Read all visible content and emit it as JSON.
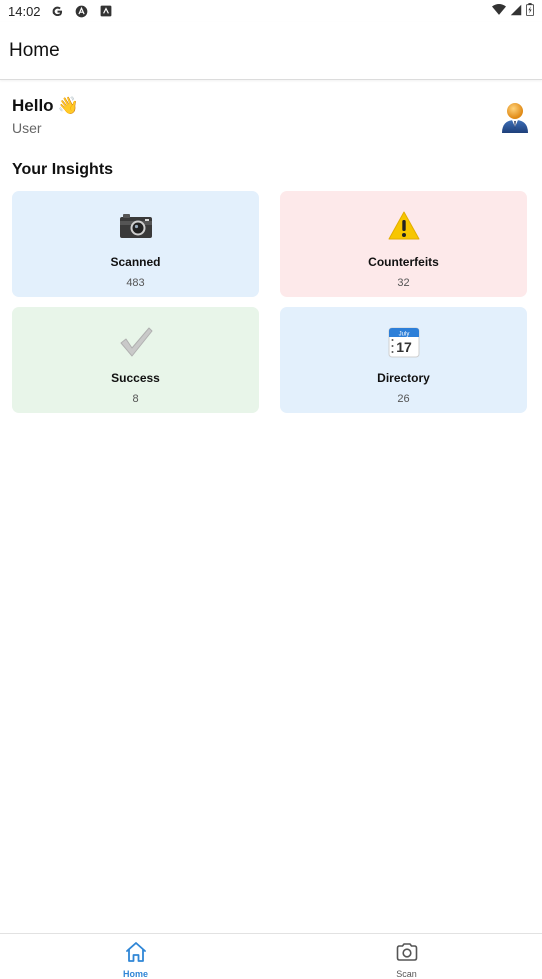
{
  "status_bar": {
    "time": "14:02",
    "icons": [
      "google-icon",
      "app-a-icon",
      "app-n-icon"
    ],
    "right_icons": [
      "wifi-icon",
      "signal-icon",
      "battery-icon"
    ]
  },
  "app_bar": {
    "title": "Home"
  },
  "greeting": {
    "hello": "Hello",
    "hello_emoji": "👋",
    "user": "User"
  },
  "insights": {
    "title": "Your Insights",
    "cards": [
      {
        "label": "Scanned",
        "value": "483",
        "icon": "camera-icon",
        "color": "#e3f0fc"
      },
      {
        "label": "Counterfeits",
        "value": "32",
        "icon": "warning-icon",
        "color": "#fde9ea"
      },
      {
        "label": "Success",
        "value": "8",
        "icon": "check-icon",
        "color": "#e8f5e9"
      },
      {
        "label": "Directory",
        "value": "26",
        "icon": "calendar-icon",
        "color": "#e3f0fc"
      }
    ]
  },
  "bottom_nav": {
    "items": [
      {
        "label": "Home",
        "icon": "home-icon",
        "active": true,
        "color": "#2f86d6"
      },
      {
        "label": "Scan",
        "icon": "camera-outline-icon",
        "active": false,
        "color": "#555555"
      }
    ]
  },
  "calendar_icon": {
    "month": "July",
    "day": "17"
  }
}
